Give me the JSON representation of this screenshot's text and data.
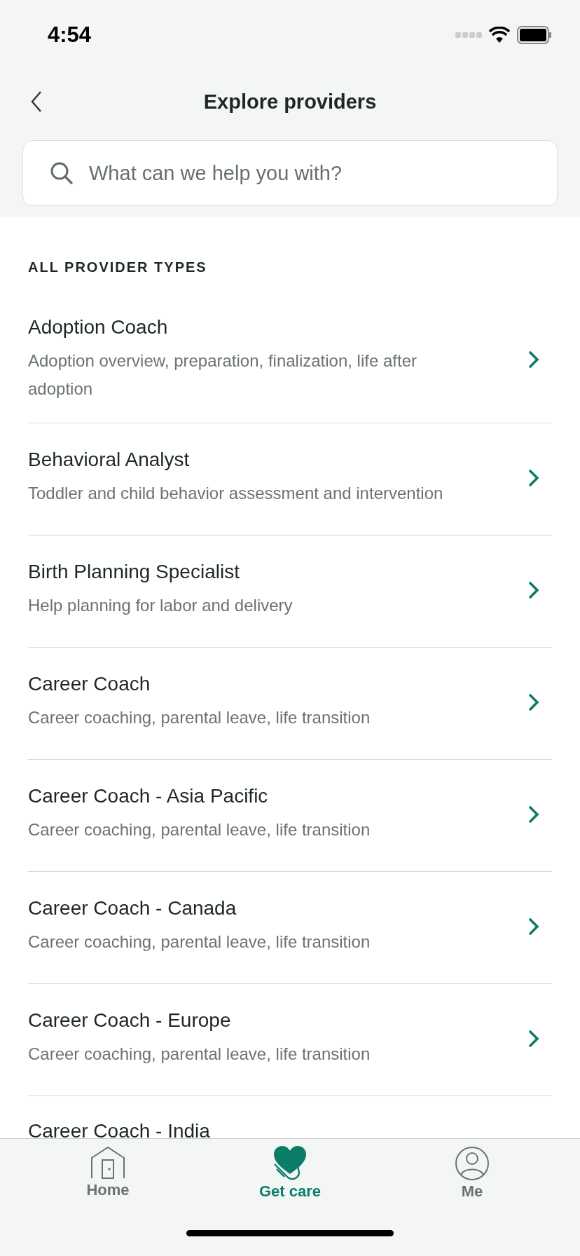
{
  "status_bar": {
    "time": "4:54"
  },
  "nav": {
    "title": "Explore providers"
  },
  "search": {
    "placeholder": "What can we help you with?"
  },
  "section": {
    "heading": "ALL PROVIDER TYPES"
  },
  "providers": [
    {
      "title": "Adoption Coach",
      "subtitle": "Adoption overview, preparation, finalization, life after adoption"
    },
    {
      "title": "Behavioral Analyst",
      "subtitle": "Toddler and child behavior assessment and intervention"
    },
    {
      "title": "Birth Planning Specialist",
      "subtitle": "Help planning for labor and delivery"
    },
    {
      "title": "Career Coach",
      "subtitle": "Career coaching, parental leave, life transition"
    },
    {
      "title": "Career Coach - Asia Pacific",
      "subtitle": "Career coaching, parental leave, life transition"
    },
    {
      "title": "Career Coach - Canada",
      "subtitle": "Career coaching, parental leave, life transition"
    },
    {
      "title": "Career Coach - Europe",
      "subtitle": "Career coaching, parental leave, life transition"
    },
    {
      "title": "Career Coach - India"
    }
  ],
  "tab_bar": [
    {
      "kind": "home",
      "label": "Home",
      "selected": false
    },
    {
      "kind": "care",
      "label": "Get care",
      "selected": true
    },
    {
      "kind": "me",
      "label": "Me",
      "selected": false
    }
  ]
}
